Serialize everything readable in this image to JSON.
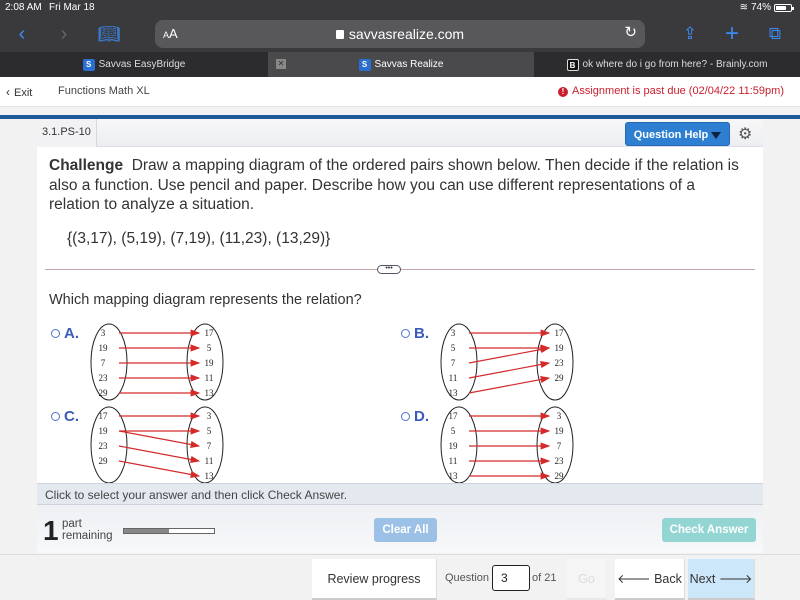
{
  "status_bar": {
    "time": "2:08 AM",
    "date": "Fri Mar 18",
    "battery_percent": "74%",
    "battery_level": 0.74
  },
  "browser": {
    "text_size_label": "AA",
    "url": "savvasrealize.com",
    "icons": [
      "back-icon",
      "forward-icon",
      "bookmarks-icon",
      "lock-icon",
      "reload-icon",
      "share-icon",
      "new-tab-icon",
      "tabs-icon"
    ],
    "tabs": [
      {
        "title": "Savvas EasyBridge",
        "favicon": "S",
        "active": false
      },
      {
        "title": "Savvas Realize",
        "favicon": "S",
        "active": true
      },
      {
        "title": "ok where do i go from here? - Brainly.com",
        "favicon": "B",
        "active": false
      }
    ]
  },
  "app_header": {
    "exit_label": "Exit",
    "course_title": "Functions Math XL",
    "past_due_notice": "Assignment is past due (02/04/22 11:59pm)"
  },
  "question": {
    "id": "3.1.PS-10",
    "help_label": "Question Help",
    "prompt_bold": "Challenge",
    "prompt_text": "Draw a mapping diagram of the ordered pairs shown below. Then decide if the relation is also a function. Use pencil and paper. Describe how you can use different representations of a relation to analyze a situation.",
    "pairs": "{(3,17), (5,19), (7,19), (11,23), (13,29)}",
    "expander_label": "•••",
    "subquestion": "Which mapping diagram represents the relation?",
    "choices": [
      {
        "letter": "A.",
        "domain": [
          "3",
          "19",
          "7",
          "23",
          "29"
        ],
        "range": [
          "17",
          "5",
          "19",
          "11",
          "13"
        ],
        "arrows": [
          [
            0,
            0
          ],
          [
            1,
            1
          ],
          [
            2,
            2
          ],
          [
            3,
            3
          ],
          [
            4,
            4
          ]
        ]
      },
      {
        "letter": "B.",
        "domain": [
          "3",
          "5",
          "7",
          "11",
          "13"
        ],
        "range": [
          "17",
          "19",
          "23",
          "29"
        ],
        "arrows": [
          [
            0,
            0
          ],
          [
            1,
            1
          ],
          [
            2,
            1
          ],
          [
            3,
            2
          ],
          [
            4,
            3
          ]
        ]
      },
      {
        "letter": "C.",
        "domain": [
          "17",
          "19",
          "23",
          "29"
        ],
        "range": [
          "3",
          "5",
          "7",
          "11",
          "13"
        ],
        "arrows": [
          [
            0,
            0
          ],
          [
            1,
            1
          ],
          [
            1,
            2
          ],
          [
            2,
            3
          ],
          [
            3,
            4
          ]
        ]
      },
      {
        "letter": "D.",
        "domain": [
          "17",
          "5",
          "19",
          "11",
          "13"
        ],
        "range": [
          "3",
          "19",
          "7",
          "23",
          "29"
        ],
        "arrows": [
          [
            0,
            0
          ],
          [
            1,
            1
          ],
          [
            2,
            2
          ],
          [
            3,
            3
          ],
          [
            4,
            4
          ]
        ]
      }
    ]
  },
  "instructions": "Click to select your answer and then click Check Answer.",
  "parts": {
    "count": "1",
    "label_line1": "part",
    "label_line2": "remaining",
    "progress": 0.5
  },
  "buttons": {
    "clear_all": "Clear All",
    "check_answer": "Check Answer"
  },
  "navigation": {
    "review_progress": "Review progress",
    "question_label": "Question",
    "question_number": "3",
    "of_total": "of 21",
    "go": "Go",
    "back": "🡐 Back",
    "next": "Next 🡒"
  },
  "colors": {
    "arrow": "#d42a2a",
    "accent": "#2e7fd1",
    "past_due": "#c8202f",
    "header_bar": "#1d5a9a"
  }
}
